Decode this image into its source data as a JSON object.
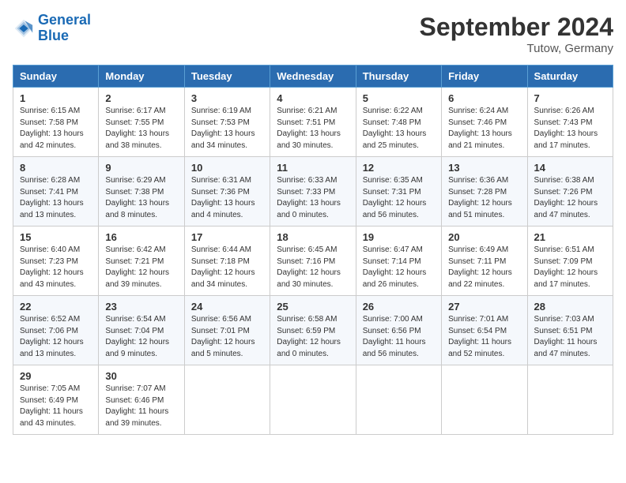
{
  "header": {
    "logo_line1": "General",
    "logo_line2": "Blue",
    "month_title": "September 2024",
    "subtitle": "Tutow, Germany"
  },
  "weekdays": [
    "Sunday",
    "Monday",
    "Tuesday",
    "Wednesday",
    "Thursday",
    "Friday",
    "Saturday"
  ],
  "weeks": [
    [
      {
        "day": "1",
        "info": "Sunrise: 6:15 AM\nSunset: 7:58 PM\nDaylight: 13 hours\nand 42 minutes."
      },
      {
        "day": "2",
        "info": "Sunrise: 6:17 AM\nSunset: 7:55 PM\nDaylight: 13 hours\nand 38 minutes."
      },
      {
        "day": "3",
        "info": "Sunrise: 6:19 AM\nSunset: 7:53 PM\nDaylight: 13 hours\nand 34 minutes."
      },
      {
        "day": "4",
        "info": "Sunrise: 6:21 AM\nSunset: 7:51 PM\nDaylight: 13 hours\nand 30 minutes."
      },
      {
        "day": "5",
        "info": "Sunrise: 6:22 AM\nSunset: 7:48 PM\nDaylight: 13 hours\nand 25 minutes."
      },
      {
        "day": "6",
        "info": "Sunrise: 6:24 AM\nSunset: 7:46 PM\nDaylight: 13 hours\nand 21 minutes."
      },
      {
        "day": "7",
        "info": "Sunrise: 6:26 AM\nSunset: 7:43 PM\nDaylight: 13 hours\nand 17 minutes."
      }
    ],
    [
      {
        "day": "8",
        "info": "Sunrise: 6:28 AM\nSunset: 7:41 PM\nDaylight: 13 hours\nand 13 minutes."
      },
      {
        "day": "9",
        "info": "Sunrise: 6:29 AM\nSunset: 7:38 PM\nDaylight: 13 hours\nand 8 minutes."
      },
      {
        "day": "10",
        "info": "Sunrise: 6:31 AM\nSunset: 7:36 PM\nDaylight: 13 hours\nand 4 minutes."
      },
      {
        "day": "11",
        "info": "Sunrise: 6:33 AM\nSunset: 7:33 PM\nDaylight: 13 hours\nand 0 minutes."
      },
      {
        "day": "12",
        "info": "Sunrise: 6:35 AM\nSunset: 7:31 PM\nDaylight: 12 hours\nand 56 minutes."
      },
      {
        "day": "13",
        "info": "Sunrise: 6:36 AM\nSunset: 7:28 PM\nDaylight: 12 hours\nand 51 minutes."
      },
      {
        "day": "14",
        "info": "Sunrise: 6:38 AM\nSunset: 7:26 PM\nDaylight: 12 hours\nand 47 minutes."
      }
    ],
    [
      {
        "day": "15",
        "info": "Sunrise: 6:40 AM\nSunset: 7:23 PM\nDaylight: 12 hours\nand 43 minutes."
      },
      {
        "day": "16",
        "info": "Sunrise: 6:42 AM\nSunset: 7:21 PM\nDaylight: 12 hours\nand 39 minutes."
      },
      {
        "day": "17",
        "info": "Sunrise: 6:44 AM\nSunset: 7:18 PM\nDaylight: 12 hours\nand 34 minutes."
      },
      {
        "day": "18",
        "info": "Sunrise: 6:45 AM\nSunset: 7:16 PM\nDaylight: 12 hours\nand 30 minutes."
      },
      {
        "day": "19",
        "info": "Sunrise: 6:47 AM\nSunset: 7:14 PM\nDaylight: 12 hours\nand 26 minutes."
      },
      {
        "day": "20",
        "info": "Sunrise: 6:49 AM\nSunset: 7:11 PM\nDaylight: 12 hours\nand 22 minutes."
      },
      {
        "day": "21",
        "info": "Sunrise: 6:51 AM\nSunset: 7:09 PM\nDaylight: 12 hours\nand 17 minutes."
      }
    ],
    [
      {
        "day": "22",
        "info": "Sunrise: 6:52 AM\nSunset: 7:06 PM\nDaylight: 12 hours\nand 13 minutes."
      },
      {
        "day": "23",
        "info": "Sunrise: 6:54 AM\nSunset: 7:04 PM\nDaylight: 12 hours\nand 9 minutes."
      },
      {
        "day": "24",
        "info": "Sunrise: 6:56 AM\nSunset: 7:01 PM\nDaylight: 12 hours\nand 5 minutes."
      },
      {
        "day": "25",
        "info": "Sunrise: 6:58 AM\nSunset: 6:59 PM\nDaylight: 12 hours\nand 0 minutes."
      },
      {
        "day": "26",
        "info": "Sunrise: 7:00 AM\nSunset: 6:56 PM\nDaylight: 11 hours\nand 56 minutes."
      },
      {
        "day": "27",
        "info": "Sunrise: 7:01 AM\nSunset: 6:54 PM\nDaylight: 11 hours\nand 52 minutes."
      },
      {
        "day": "28",
        "info": "Sunrise: 7:03 AM\nSunset: 6:51 PM\nDaylight: 11 hours\nand 47 minutes."
      }
    ],
    [
      {
        "day": "29",
        "info": "Sunrise: 7:05 AM\nSunset: 6:49 PM\nDaylight: 11 hours\nand 43 minutes."
      },
      {
        "day": "30",
        "info": "Sunrise: 7:07 AM\nSunset: 6:46 PM\nDaylight: 11 hours\nand 39 minutes."
      },
      {
        "day": "",
        "info": ""
      },
      {
        "day": "",
        "info": ""
      },
      {
        "day": "",
        "info": ""
      },
      {
        "day": "",
        "info": ""
      },
      {
        "day": "",
        "info": ""
      }
    ]
  ]
}
